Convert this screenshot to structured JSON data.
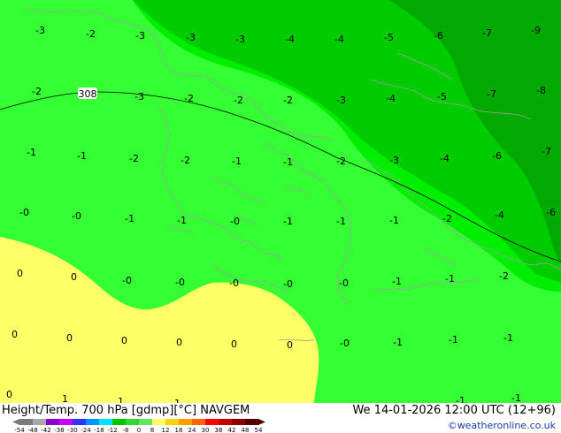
{
  "footer": {
    "title": "Height/Temp. 700 hPa [gdmp][°C] NAVGEM",
    "datetime": "We 14-01-2026 12:00 UTC (12+96)",
    "credit": "©weatheronline.co.uk"
  },
  "contour": {
    "label": "308"
  },
  "legend": {
    "ticks": [
      "-54",
      "-48",
      "-42",
      "-38",
      "-30",
      "-24",
      "-18",
      "-12",
      "-8",
      "0",
      "8",
      "12",
      "18",
      "24",
      "30",
      "38",
      "42",
      "48",
      "54"
    ],
    "colors": [
      "#7a7a7a",
      "#a8a8a8",
      "#8c00c8",
      "#c800ff",
      "#3232ff",
      "#0096ff",
      "#00e1ff",
      "#00c800",
      "#32d732",
      "#64e664",
      "#ffff64",
      "#ffd200",
      "#ffa000",
      "#ff6400",
      "#ff0000",
      "#c80000",
      "#8c0000",
      "#500000"
    ]
  },
  "zones": {
    "yellow": "#ffff66",
    "light_green": "#33ff33",
    "green": "#00ee00",
    "mid_green": "#00cc00",
    "dark_green": "#00aa00"
  },
  "temps": [
    "-3",
    "-2",
    "-3",
    "-3",
    "-3",
    "-4",
    "-4",
    "-5",
    "-6",
    "-7",
    "-9",
    "-2",
    "-3",
    "-2",
    "-2",
    "-2",
    "-3",
    "-4",
    "-5",
    "-7",
    "-8",
    "-1",
    "-1",
    "-2",
    "-2",
    "-1",
    "-1",
    "-2",
    "-3",
    "-4",
    "-6",
    "-7",
    "-0",
    "-0",
    "-1",
    "-1",
    "-0",
    "-1",
    "-1",
    "-1",
    "-2",
    "-4",
    "-6",
    "0",
    "0",
    "-0",
    "-0",
    "-0",
    "-0",
    "-0",
    "-1",
    "-1",
    "-2",
    "0",
    "0",
    "0",
    "0",
    "0",
    "0",
    "-0",
    "-1",
    "-1",
    "-1",
    "0",
    "1",
    "1",
    "1",
    "-1",
    "-1"
  ]
}
